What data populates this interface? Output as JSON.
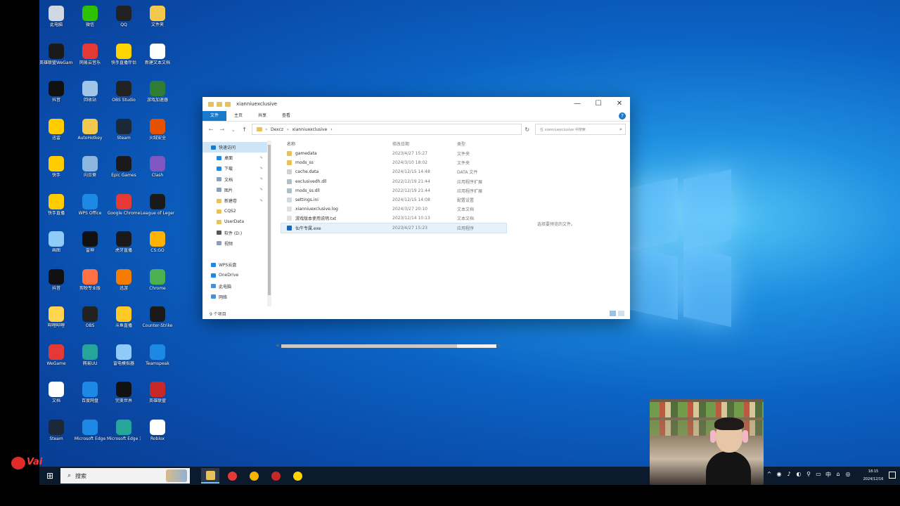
{
  "colors": {
    "accent": "#1979ca",
    "folder": "#e7c25a",
    "taskbar": "#0c1a2e"
  },
  "desktop_icons": [
    {
      "label": "此电脑",
      "color": "#cfd8e3"
    },
    {
      "label": "微信",
      "color": "#2dc100"
    },
    {
      "label": "QQ",
      "color": "#222"
    },
    {
      "label": "文件夹",
      "color": "#f2c94c"
    },
    {
      "label": "英雄联盟WeGame",
      "color": "#1a1a1a"
    },
    {
      "label": "网易云音乐",
      "color": "#e53935"
    },
    {
      "label": "快手直播伴侣",
      "color": "#ffd400"
    },
    {
      "label": "新建文本文档",
      "color": "#fff"
    },
    {
      "label": "抖音",
      "color": "#111"
    },
    {
      "label": "回收站",
      "color": "#9fc6e8"
    },
    {
      "label": "OBS Studio",
      "color": "#222"
    },
    {
      "label": "游戏加速器",
      "color": "#2e7d32"
    },
    {
      "label": "迅雷",
      "color": "#ffcc00"
    },
    {
      "label": "AutoHotkey",
      "color": "#f2c94c"
    },
    {
      "label": "Steam",
      "color": "#1b2838"
    },
    {
      "label": "火绒安全",
      "color": "#e65100"
    },
    {
      "label": "快手",
      "color": "#ffcc00"
    },
    {
      "label": "向日葵",
      "color": "#8bb6e0"
    },
    {
      "label": "Epic Games",
      "color": "#1a1a1a"
    },
    {
      "label": "Clash",
      "color": "#7e57c2"
    },
    {
      "label": "快手直播",
      "color": "#ffcc00"
    },
    {
      "label": "WPS Office",
      "color": "#1e88e5"
    },
    {
      "label": "Google Chrome",
      "color": "#e53935"
    },
    {
      "label": "League of Legends",
      "color": "#1a1a1a"
    },
    {
      "label": "画图",
      "color": "#90caf9"
    },
    {
      "label": "雷神",
      "color": "#111"
    },
    {
      "label": "虎牙直播",
      "color": "#1a1a1a"
    },
    {
      "label": "CS:GO",
      "color": "#ffb300"
    },
    {
      "label": "抖音",
      "color": "#111"
    },
    {
      "label": "剪映专业版",
      "color": "#ff7043"
    },
    {
      "label": "迅游",
      "color": "#f57c00"
    },
    {
      "label": "Chrome",
      "color": "#4caf50"
    },
    {
      "label": "哔哩哔哩",
      "color": "#ffd54f"
    },
    {
      "label": "OBS",
      "color": "#222"
    },
    {
      "label": "斗鱼直播",
      "color": "#ffca28"
    },
    {
      "label": "Counter-Strike",
      "color": "#1a1a1a"
    },
    {
      "label": "WeGame",
      "color": "#e53935"
    },
    {
      "label": "网易UU",
      "color": "#26a69a"
    },
    {
      "label": "雷电模拟器",
      "color": "#90caf9"
    },
    {
      "label": "Teamspeak",
      "color": "#1e88e5"
    },
    {
      "label": "文档",
      "color": "#fff"
    },
    {
      "label": "百度网盘",
      "color": "#1e88e5"
    },
    {
      "label": "完美世界",
      "color": "#111"
    },
    {
      "label": "英雄联盟",
      "color": "#c62828"
    },
    {
      "label": "Steam",
      "color": "#1b2838"
    },
    {
      "label": "Microsoft Edge",
      "color": "#1e88e5"
    },
    {
      "label": "Microsoft Edge 测试版",
      "color": "#26a69a"
    },
    {
      "label": "Roblox",
      "color": "#fff"
    }
  ],
  "explorer": {
    "title": "xianniuexclusive",
    "window_controls": {
      "minimize": "—",
      "maximize": "☐",
      "close": "✕"
    },
    "ribbon_tabs": [
      "文件",
      "主页",
      "共享",
      "查看"
    ],
    "help": "?",
    "nav_buttons": {
      "back": "←",
      "forward": "→",
      "recent": "⌄",
      "up": "↑"
    },
    "path": [
      "Dexcz",
      "xianniuexclusive"
    ],
    "path_sep": "›",
    "refresh": "↻",
    "search_placeholder": "在 xianniuexclusive 中搜索",
    "search_icon": "⌕",
    "nav_items": [
      {
        "label": "快速访问",
        "color": "#1979ca",
        "indent": 0,
        "sel": true,
        "pin": ""
      },
      {
        "label": "桌面",
        "color": "#1e88e5",
        "indent": 1,
        "pin": "✎"
      },
      {
        "label": "下载",
        "color": "#1e88e5",
        "indent": 1,
        "pin": "✎"
      },
      {
        "label": "文档",
        "color": "#8aa0b8",
        "indent": 1,
        "pin": "✎"
      },
      {
        "label": "图片",
        "color": "#8aa0b8",
        "indent": 1,
        "pin": "✎"
      },
      {
        "label": "新建卷",
        "color": "#e7c25a",
        "indent": 1,
        "pin": "✎"
      },
      {
        "label": "CQS2",
        "color": "#e7c25a",
        "indent": 1,
        "pin": ""
      },
      {
        "label": "UserData",
        "color": "#e7c25a",
        "indent": 1,
        "pin": ""
      },
      {
        "label": "软件 (D:)",
        "color": "#555",
        "indent": 1,
        "pin": ""
      },
      {
        "label": "视频",
        "color": "#8aa0b8",
        "indent": 1,
        "pin": ""
      },
      {
        "label": "",
        "color": "transparent",
        "indent": 0,
        "pin": ""
      },
      {
        "label": "WPS云盘",
        "color": "#1e88e5",
        "indent": 0,
        "pin": ""
      },
      {
        "label": "OneDrive",
        "color": "#1e88e5",
        "indent": 0,
        "pin": ""
      },
      {
        "label": "此电脑",
        "color": "#4a90d9",
        "indent": 0,
        "pin": ""
      },
      {
        "label": "网络",
        "color": "#4a90d9",
        "indent": 0,
        "pin": ""
      }
    ],
    "columns": [
      "名称",
      "修改日期",
      "类型"
    ],
    "files": [
      {
        "name": "gamedata",
        "date": "2023/4/27 15:27",
        "type": "文件夹",
        "color": "#e7c25a"
      },
      {
        "name": "mods_ss",
        "date": "2024/3/10 18:02",
        "type": "文件夹",
        "color": "#e7c25a"
      },
      {
        "name": "cache.data",
        "date": "2024/12/15 14:48",
        "type": "DATA 文件",
        "color": "#cfcfcf"
      },
      {
        "name": "exclusivedh.dll",
        "date": "2022/12/19 21:44",
        "type": "应用程序扩展",
        "color": "#b0bec5"
      },
      {
        "name": "mods_ss.dll",
        "date": "2022/12/19 21:44",
        "type": "应用程序扩展",
        "color": "#b0bec5"
      },
      {
        "name": "settings.ini",
        "date": "2024/12/15 14:08",
        "type": "配置设置",
        "color": "#cfd8dc"
      },
      {
        "name": "xianniuexclusive.log",
        "date": "2024/3/27 20:10",
        "type": "文本文档",
        "color": "#e0e0e0"
      },
      {
        "name": "游戏版本使用说明.txt",
        "date": "2023/12/14 10:13",
        "type": "文本文档",
        "color": "#e0e0e0"
      },
      {
        "name": "仙牛专属.exe",
        "date": "2023/4/27 15:23",
        "type": "应用程序",
        "color": "#1565c0",
        "sel": true
      }
    ],
    "preview_text": "选择要预览的文件。",
    "status": "9 个项目",
    "scroll_arrows": {
      "left": "◀",
      "right": "▶"
    }
  },
  "taskbar": {
    "start_icon": "⊞",
    "search_label": "搜索",
    "search_icon": "⌕",
    "apps": [
      {
        "color": "#e7c25a",
        "active": true
      },
      {
        "color": "#e53935",
        "active": false
      },
      {
        "color": "#f4b400",
        "active": false
      },
      {
        "color": "#c62828",
        "active": false
      },
      {
        "color": "#ffd400",
        "active": false
      }
    ],
    "tray": [
      "^",
      "◉",
      "♪",
      "◐",
      "⚲",
      "▭",
      "中",
      "⌂",
      "◎"
    ],
    "time": "18:15",
    "date": "2024/12/16"
  },
  "overlay_logo": "Vai"
}
